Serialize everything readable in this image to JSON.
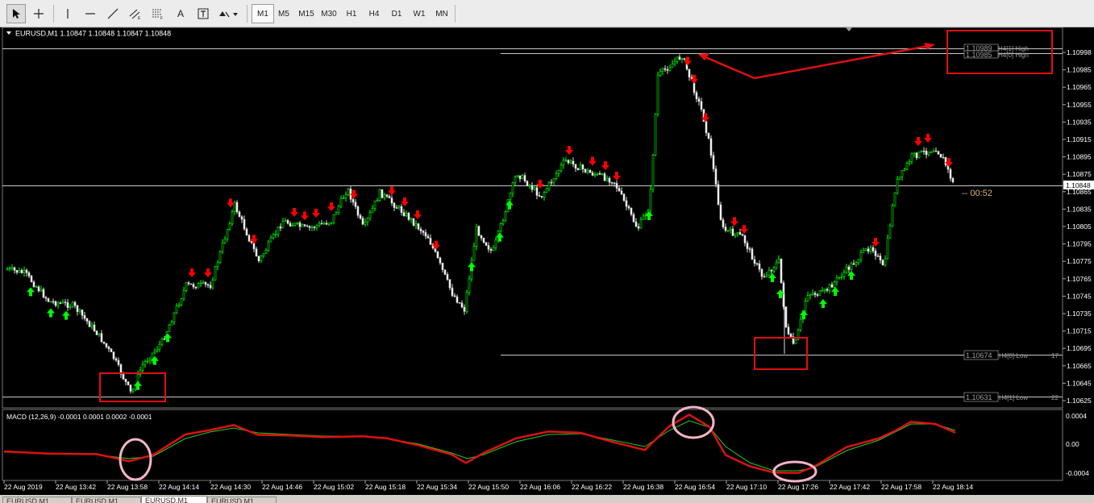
{
  "toolbar": {
    "tools": [
      "cursor-icon",
      "crosshair-icon",
      "vertical-line-icon",
      "horizontal-line-icon",
      "trendline-icon",
      "equidistant-channel-icon",
      "fibonacci-icon",
      "text-icon",
      "text-label-icon",
      "arrows-icon"
    ],
    "text_tool_label": "A",
    "timeframes": [
      "M1",
      "M5",
      "M15",
      "M30",
      "H1",
      "H4",
      "D1",
      "W1",
      "MN"
    ],
    "active_timeframe": "M1"
  },
  "chart": {
    "symbol_header": "EURUSD,M1  1.10847 1.10848 1.10847 1.10848",
    "price_labels": [
      "1.10998",
      "1.10985",
      "1.10965",
      "1.10955",
      "1.10935",
      "1.10915",
      "1.10895",
      "1.10875",
      "1.10865",
      "1.10835",
      "1.10805",
      "1.10795",
      "1.10775",
      "1.10765",
      "1.10745",
      "1.10735",
      "1.10715",
      "1.10695",
      "1.10665",
      "1.10645",
      "1.10625"
    ],
    "current_price": "1.10848",
    "countdown": "-- 00:52",
    "levels": [
      {
        "value": "1.10989",
        "label": "H4[1] High"
      },
      {
        "value": "1.10985",
        "label": "H4[0] High"
      },
      {
        "value": "1.10674",
        "label": "H4[0] Low"
      },
      {
        "value": "1.10631",
        "label": "H4[1] Low"
      }
    ],
    "level_side_marks": [
      "17",
      "22"
    ],
    "bull_color": "#00ff00",
    "bear_color": "#ff0000",
    "up_arrow_color": "#00ff00",
    "down_arrow_color": "#ff0000",
    "annotation_color": "#e01010"
  },
  "macd": {
    "header": "MACD (12,26,9) -0.0001 0.0001 0.0002 -0.0001",
    "scale_labels": [
      "0.0004",
      "0.00",
      "-0.0004"
    ],
    "main_color": "#e01010",
    "signal_color": "#22cc22",
    "highlight_color": "#f3b4c8"
  },
  "time_axis": [
    "22 Aug 2019",
    "22 Aug 13:42",
    "22 Aug 13:58",
    "22 Aug 14:14",
    "22 Aug 14:30",
    "22 Aug 14:46",
    "22 Aug 15:02",
    "22 Aug 15:18",
    "22 Aug 15:34",
    "22 Aug 15:50",
    "22 Aug 16:06",
    "22 Aug 16:22",
    "22 Aug 16:38",
    "22 Aug 16:54",
    "22 Aug 17:10",
    "22 Aug 17:26",
    "22 Aug 17:42",
    "22 Aug 17:58",
    "22 Aug 18:14"
  ],
  "tabs": [
    "EURUSD,M1",
    "EURUSD,M1",
    "EURUSD,M1",
    "EURUSD,M1"
  ],
  "active_tab": 2
}
